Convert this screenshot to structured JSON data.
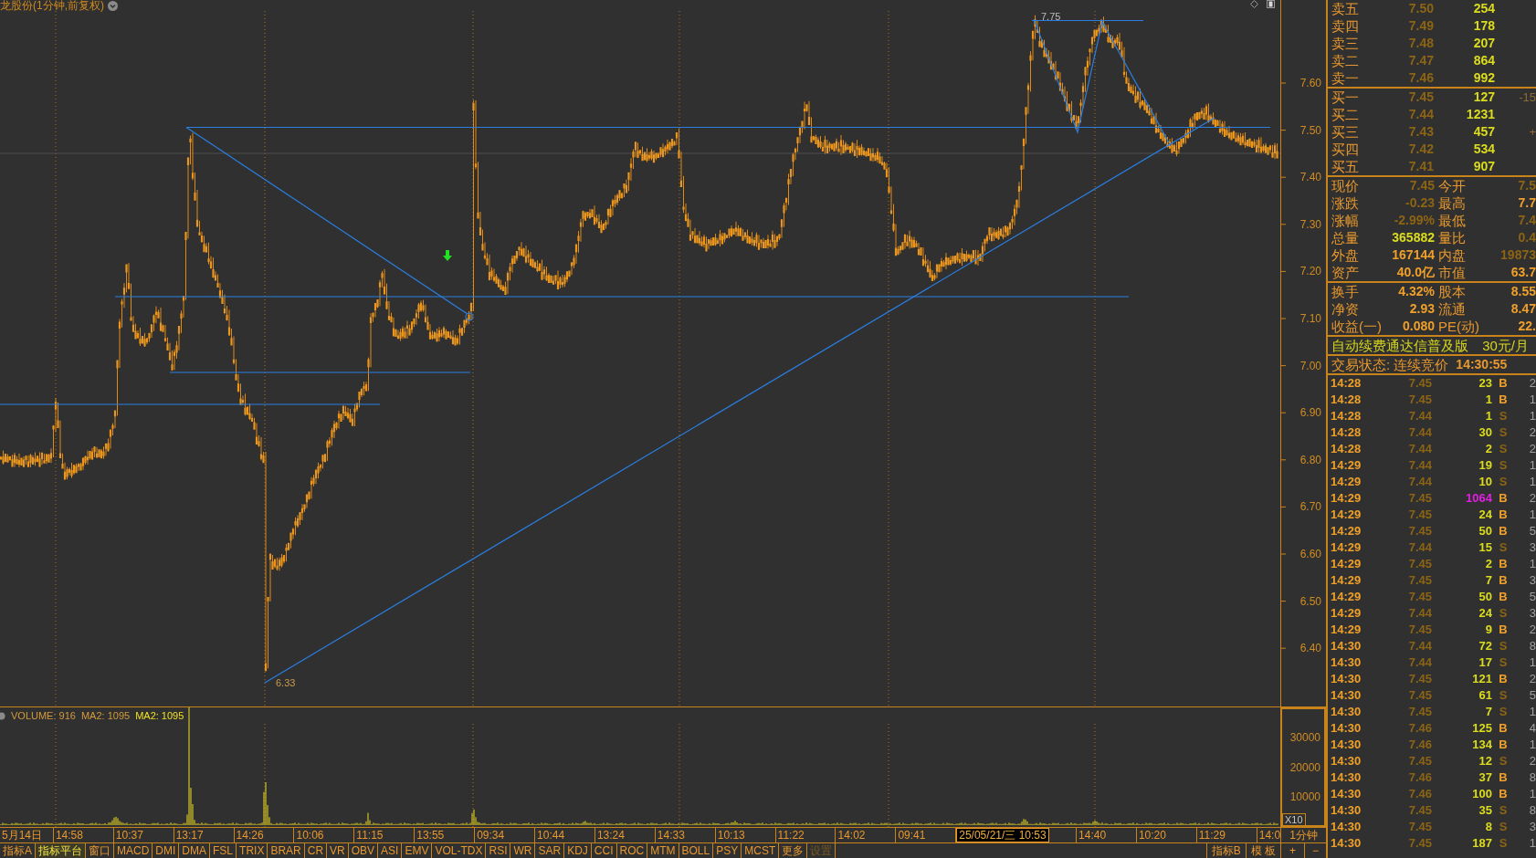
{
  "chart": {
    "title": "龙股份(1分钟,前复权)",
    "price_axis": [
      "7.60",
      "7.50",
      "7.40",
      "7.30",
      "7.20",
      "7.10",
      "7.00",
      "6.90",
      "6.80",
      "6.70",
      "6.60",
      "6.50",
      "6.40"
    ],
    "high_label": "7.75",
    "low_label": "6.33"
  },
  "volume_pane": {
    "legend": [
      {
        "text": "VOLUME: 916",
        "color": "#d39b3c"
      },
      {
        "text": "MA2: 1095",
        "color": "#d39b3c"
      },
      {
        "text": "MA2: 1095",
        "color": "#f0e020"
      }
    ],
    "axis": [
      "30000",
      "20000",
      "10000"
    ],
    "scale": "X10"
  },
  "time_axis": {
    "labels": [
      {
        "text": "5月14日",
        "selected": false
      },
      {
        "text": "14:58",
        "selected": false
      },
      {
        "text": "10:37",
        "selected": false
      },
      {
        "text": "13:17",
        "selected": false
      },
      {
        "text": "14:26",
        "selected": false
      },
      {
        "text": "10:06",
        "selected": false
      },
      {
        "text": "11:15",
        "selected": false
      },
      {
        "text": "13:55",
        "selected": false
      },
      {
        "text": "09:34",
        "selected": false
      },
      {
        "text": "10:44",
        "selected": false
      },
      {
        "text": "13:24",
        "selected": false
      },
      {
        "text": "14:33",
        "selected": false
      },
      {
        "text": "10:13",
        "selected": false
      },
      {
        "text": "11:22",
        "selected": false
      },
      {
        "text": "14:02",
        "selected": false
      },
      {
        "text": "09:41",
        "selected": false
      },
      {
        "text": "25/05/21/三 10:53",
        "selected": true
      },
      {
        "text": "14:40",
        "selected": false
      },
      {
        "text": "10:20",
        "selected": false
      },
      {
        "text": "11:29",
        "selected": false
      },
      {
        "text": "14:0",
        "selected": false
      }
    ],
    "period": "1分钟"
  },
  "indicator_tabs": [
    {
      "label": "指标A",
      "selected": false,
      "disabled": false
    },
    {
      "label": "指标平台",
      "selected": true,
      "disabled": false
    },
    {
      "label": "窗口",
      "selected": false,
      "disabled": false
    },
    {
      "label": "MACD",
      "selected": false,
      "disabled": false
    },
    {
      "label": "DMI",
      "selected": false,
      "disabled": false
    },
    {
      "label": "DMA",
      "selected": false,
      "disabled": false
    },
    {
      "label": "FSL",
      "selected": false,
      "disabled": false
    },
    {
      "label": "TRIX",
      "selected": false,
      "disabled": false
    },
    {
      "label": "BRAR",
      "selected": false,
      "disabled": false
    },
    {
      "label": "CR",
      "selected": false,
      "disabled": false
    },
    {
      "label": "VR",
      "selected": false,
      "disabled": false
    },
    {
      "label": "OBV",
      "selected": false,
      "disabled": false
    },
    {
      "label": "ASI",
      "selected": false,
      "disabled": false
    },
    {
      "label": "EMV",
      "selected": false,
      "disabled": false
    },
    {
      "label": "VOL-TDX",
      "selected": false,
      "disabled": false
    },
    {
      "label": "RSI",
      "selected": false,
      "disabled": false
    },
    {
      "label": "WR",
      "selected": false,
      "disabled": false
    },
    {
      "label": "SAR",
      "selected": false,
      "disabled": false
    },
    {
      "label": "KDJ",
      "selected": false,
      "disabled": false
    },
    {
      "label": "CCI",
      "selected": false,
      "disabled": false
    },
    {
      "label": "ROC",
      "selected": false,
      "disabled": false
    },
    {
      "label": "MTM",
      "selected": false,
      "disabled": false
    },
    {
      "label": "BOLL",
      "selected": false,
      "disabled": false
    },
    {
      "label": "PSY",
      "selected": false,
      "disabled": false
    },
    {
      "label": "MCST",
      "selected": false,
      "disabled": false
    },
    {
      "label": "更多",
      "selected": false,
      "disabled": false
    },
    {
      "label": "设置",
      "selected": false,
      "disabled": true
    }
  ],
  "right_tabs": [
    "指标B",
    "模 板"
  ],
  "zoom_buttons": [
    "+",
    "−"
  ],
  "order_book": {
    "asks": [
      {
        "label": "卖五",
        "price": "7.50",
        "volume": "254"
      },
      {
        "label": "卖四",
        "price": "7.49",
        "volume": "178"
      },
      {
        "label": "卖三",
        "price": "7.48",
        "volume": "207"
      },
      {
        "label": "卖二",
        "price": "7.47",
        "volume": "864"
      },
      {
        "label": "卖一",
        "price": "7.46",
        "volume": "992"
      }
    ],
    "bids": [
      {
        "label": "买一",
        "price": "7.45",
        "volume": "127",
        "column_4": "-15"
      },
      {
        "label": "买二",
        "price": "7.44",
        "volume": "1231"
      },
      {
        "label": "买三",
        "price": "7.43",
        "volume": "457",
        "column_4": "+"
      },
      {
        "label": "买四",
        "price": "7.42",
        "volume": "534"
      },
      {
        "label": "买五",
        "price": "7.41",
        "volume": "907"
      }
    ]
  },
  "quote_stats": [
    {
      "left": {
        "label": "现价",
        "value": "7.45",
        "color": "#8c6414"
      },
      "right": {
        "label": "今开",
        "value": "7.5",
        "color": "#8c6414"
      }
    },
    {
      "left": {
        "label": "涨跌",
        "value": "-0.23",
        "color": "#8c6414"
      },
      "right": {
        "label": "最高",
        "value": "7.7",
        "color": "#f0a02a"
      }
    },
    {
      "left": {
        "label": "涨幅",
        "value": "-2.99%",
        "color": "#8c6414"
      },
      "right": {
        "label": "最低",
        "value": "7.4",
        "color": "#8c6414"
      }
    },
    {
      "left": {
        "label": "总量",
        "value": "365882",
        "color": "#dcdc1e"
      },
      "right": {
        "label": "量比",
        "value": "0.4",
        "color": "#8c6414"
      }
    },
    {
      "left": {
        "label": "外盘",
        "value": "167144",
        "color": "#f0a02a"
      },
      "right": {
        "label": "内盘",
        "value": "19873",
        "color": "#8c6414"
      }
    },
    {
      "left": {
        "label": "资产",
        "value": "40.0亿",
        "color": "#f0a02a"
      },
      "right": {
        "label": "市值",
        "value": "63.7",
        "color": "#f0a02a"
      }
    }
  ],
  "fundamentals": [
    {
      "left": {
        "label": "换手",
        "value": "4.32%",
        "color": "#f0a02a"
      },
      "right": {
        "label": "股本",
        "value": "8.55",
        "color": "#f0a02a"
      }
    },
    {
      "left": {
        "label": "净资",
        "value": "2.93",
        "color": "#f0a02a"
      },
      "right": {
        "label": "流通",
        "value": "8.47",
        "color": "#f0a02a"
      }
    },
    {
      "left": {
        "label": "收益(一)",
        "value": "0.080",
        "color": "#f0a02a"
      },
      "right": {
        "label": "PE(动)",
        "value": "22.",
        "color": "#f0a02a"
      }
    }
  ],
  "promo": {
    "text": "自动续费通达信普及版",
    "price": "30元/月"
  },
  "trading_status": {
    "label": "交易状态: 连续竞价",
    "time": "14:30:55"
  },
  "trades": [
    {
      "time": "14:28",
      "price": "7.45",
      "volume": "23",
      "side": "B",
      "kind": "buy",
      "highlighted": false,
      "column_5": "2"
    },
    {
      "time": "14:28",
      "price": "7.45",
      "volume": "1",
      "side": "B",
      "kind": "buy",
      "highlighted": false,
      "column_5": "1"
    },
    {
      "time": "14:28",
      "price": "7.44",
      "volume": "1",
      "side": "S",
      "kind": "sell",
      "highlighted": false,
      "column_5": "1"
    },
    {
      "time": "14:28",
      "price": "7.44",
      "volume": "30",
      "side": "S",
      "kind": "sell",
      "highlighted": false,
      "column_5": "2"
    },
    {
      "time": "14:28",
      "price": "7.44",
      "volume": "2",
      "side": "S",
      "kind": "sell",
      "highlighted": false,
      "column_5": "2"
    },
    {
      "time": "14:29",
      "price": "7.44",
      "volume": "19",
      "side": "S",
      "kind": "sell",
      "highlighted": false,
      "column_5": "1"
    },
    {
      "time": "14:29",
      "price": "7.44",
      "volume": "10",
      "side": "S",
      "kind": "sell",
      "highlighted": false,
      "column_5": "1"
    },
    {
      "time": "14:29",
      "price": "7.45",
      "volume": "1064",
      "side": "B",
      "kind": "buy",
      "highlighted": true,
      "column_5": "2"
    },
    {
      "time": "14:29",
      "price": "7.45",
      "volume": "24",
      "side": "B",
      "kind": "buy",
      "highlighted": false,
      "column_5": "1"
    },
    {
      "time": "14:29",
      "price": "7.45",
      "volume": "50",
      "side": "B",
      "kind": "buy",
      "highlighted": false,
      "column_5": "5"
    },
    {
      "time": "14:29",
      "price": "7.44",
      "volume": "15",
      "side": "S",
      "kind": "sell",
      "highlighted": false,
      "column_5": "3"
    },
    {
      "time": "14:29",
      "price": "7.45",
      "volume": "2",
      "side": "B",
      "kind": "buy",
      "highlighted": false,
      "column_5": "1"
    },
    {
      "time": "14:29",
      "price": "7.45",
      "volume": "7",
      "side": "B",
      "kind": "buy",
      "highlighted": false,
      "column_5": "3"
    },
    {
      "time": "14:29",
      "price": "7.45",
      "volume": "50",
      "side": "B",
      "kind": "buy",
      "highlighted": false,
      "column_5": "5"
    },
    {
      "time": "14:29",
      "price": "7.44",
      "volume": "24",
      "side": "S",
      "kind": "sell",
      "highlighted": false,
      "column_5": "3"
    },
    {
      "time": "14:29",
      "price": "7.45",
      "volume": "9",
      "side": "B",
      "kind": "buy",
      "highlighted": false,
      "column_5": "2"
    },
    {
      "time": "14:30",
      "price": "7.44",
      "volume": "72",
      "side": "S",
      "kind": "sell",
      "highlighted": false,
      "column_5": "8"
    },
    {
      "time": "14:30",
      "price": "7.44",
      "volume": "17",
      "side": "S",
      "kind": "sell",
      "highlighted": false,
      "column_5": "1"
    },
    {
      "time": "14:30",
      "price": "7.45",
      "volume": "121",
      "side": "B",
      "kind": "buy",
      "highlighted": false,
      "column_5": "2"
    },
    {
      "time": "14:30",
      "price": "7.45",
      "volume": "61",
      "side": "S",
      "kind": "sell",
      "highlighted": false,
      "column_5": "5"
    },
    {
      "time": "14:30",
      "price": "7.45",
      "volume": "7",
      "side": "S",
      "kind": "sell",
      "highlighted": false,
      "column_5": "1"
    },
    {
      "time": "14:30",
      "price": "7.46",
      "volume": "125",
      "side": "B",
      "kind": "buy",
      "highlighted": false,
      "column_5": "4"
    },
    {
      "time": "14:30",
      "price": "7.46",
      "volume": "134",
      "side": "B",
      "kind": "buy",
      "highlighted": false,
      "column_5": "1"
    },
    {
      "time": "14:30",
      "price": "7.45",
      "volume": "12",
      "side": "S",
      "kind": "sell",
      "highlighted": false,
      "column_5": "2"
    },
    {
      "time": "14:30",
      "price": "7.46",
      "volume": "37",
      "side": "B",
      "kind": "buy",
      "highlighted": false,
      "column_5": "8"
    },
    {
      "time": "14:30",
      "price": "7.46",
      "volume": "100",
      "side": "B",
      "kind": "buy",
      "highlighted": false,
      "column_5": "1"
    },
    {
      "time": "14:30",
      "price": "7.45",
      "volume": "35",
      "side": "S",
      "kind": "sell",
      "highlighted": false,
      "column_5": "8"
    },
    {
      "time": "14:30",
      "price": "7.45",
      "volume": "8",
      "side": "S",
      "kind": "sell",
      "highlighted": false,
      "column_5": "3"
    },
    {
      "time": "14:30",
      "price": "7.45",
      "volume": "187",
      "side": "S",
      "kind": "sell",
      "highlighted": false,
      "column_5": "1"
    }
  ]
}
